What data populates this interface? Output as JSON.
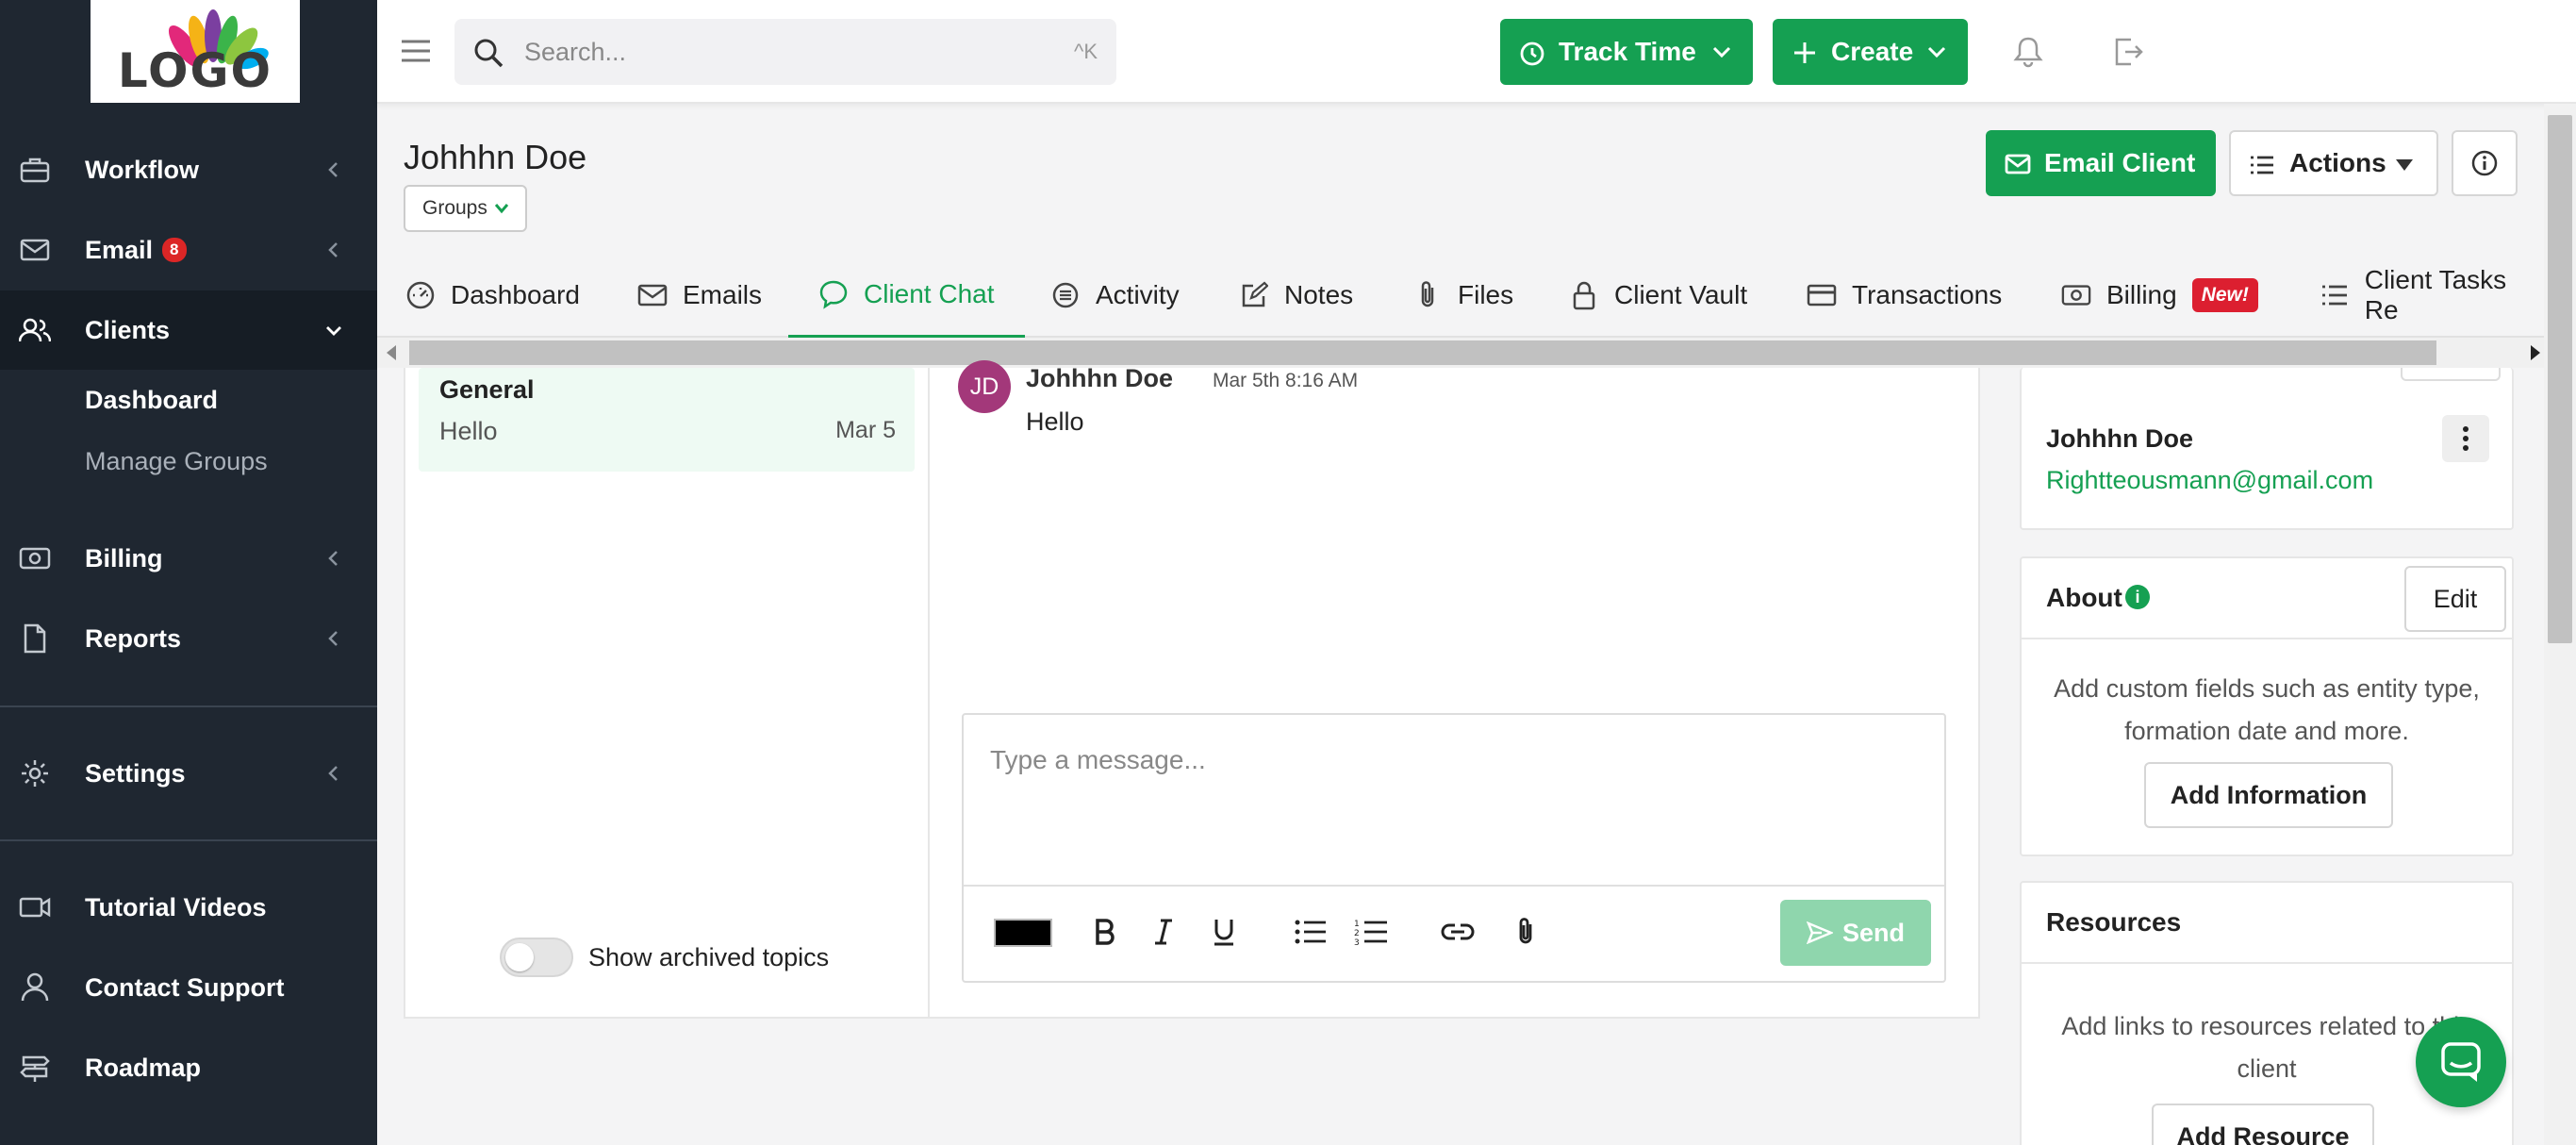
{
  "sidebar": {
    "logo_text": "LOGO",
    "items": [
      {
        "label": "Workflow",
        "icon": "briefcase-icon"
      },
      {
        "label": "Email",
        "icon": "mail-icon",
        "badge": "8"
      },
      {
        "label": "Clients",
        "icon": "users-icon"
      },
      {
        "label": "Billing",
        "icon": "money-icon"
      },
      {
        "label": "Reports",
        "icon": "document-icon"
      },
      {
        "label": "Settings",
        "icon": "gear-icon"
      },
      {
        "label": "Tutorial Videos",
        "icon": "video-icon"
      },
      {
        "label": "Contact Support",
        "icon": "person-icon"
      },
      {
        "label": "Roadmap",
        "icon": "signpost-icon"
      }
    ],
    "clients_sub": [
      "Dashboard",
      "Manage Groups"
    ]
  },
  "topbar": {
    "search_placeholder": "Search...",
    "search_shortcut": "^K",
    "track_time": "Track Time",
    "create": "Create"
  },
  "header": {
    "client_name": "Johhhn Doe",
    "groups": "Groups",
    "email_client": "Email Client",
    "actions": "Actions"
  },
  "tabs": [
    {
      "label": "Dashboard",
      "icon": "gauge-icon"
    },
    {
      "label": "Emails",
      "icon": "mail-icon"
    },
    {
      "label": "Client Chat",
      "icon": "chat-icon",
      "active": true
    },
    {
      "label": "Activity",
      "icon": "list-icon"
    },
    {
      "label": "Notes",
      "icon": "edit-icon"
    },
    {
      "label": "Files",
      "icon": "paperclip-icon"
    },
    {
      "label": "Client Vault",
      "icon": "lock-icon"
    },
    {
      "label": "Transactions",
      "icon": "card-icon"
    },
    {
      "label": "Billing",
      "icon": "money-icon",
      "badge": "New!"
    },
    {
      "label": "Client Tasks Re",
      "icon": "tasks-icon"
    }
  ],
  "chat": {
    "topic": {
      "title": "General",
      "preview": "Hello",
      "date": "Mar 5"
    },
    "show_archived": "Show archived topics",
    "message": {
      "initials": "JD",
      "author": "Johhhn Doe",
      "time": "Mar 5th 8:16 AM",
      "body": "Hello"
    },
    "composer_placeholder": "Type a message...",
    "send": "Send"
  },
  "right_panel": {
    "contact": {
      "name": "Johhhn Doe",
      "email": "Rightteousmann@gmail.com"
    },
    "about": {
      "title": "About",
      "edit": "Edit",
      "text": "Add custom fields such as entity type, formation date and more.",
      "button": "Add Information"
    },
    "resources": {
      "title": "Resources",
      "text": "Add links to resources related to this client",
      "button": "Add Resource"
    }
  },
  "colors": {
    "accent": "#15a052",
    "sidebar_bg": "#1f2731",
    "badge_red": "#dc1f30"
  }
}
